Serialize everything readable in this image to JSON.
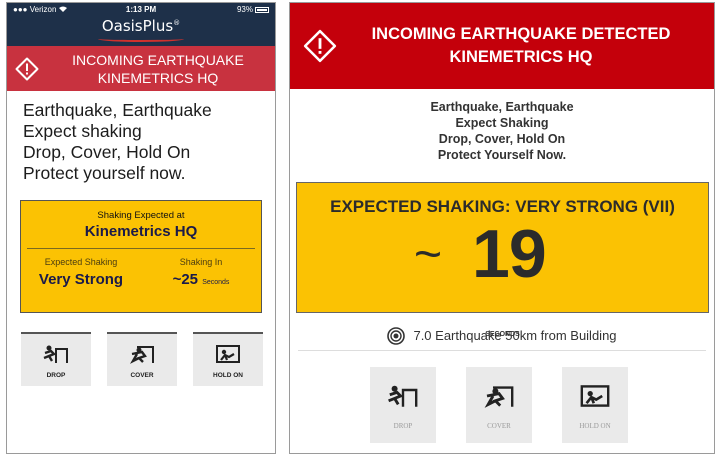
{
  "phone": {
    "status": {
      "carrier": "Verizon",
      "time": "1:13 PM",
      "battery": "93%"
    },
    "app_title": "OasisPlus",
    "banner": {
      "line1": "INCOMING EARTHQUAKE",
      "line2": "KINEMETRICS HQ"
    },
    "message": [
      "Earthquake, Earthquake",
      "Expect shaking",
      "Drop, Cover, Hold On",
      "Protect yourself now."
    ],
    "card": {
      "label": "Shaking Expected at",
      "location": "Kinemetrics HQ",
      "expected_label": "Expected Shaking",
      "expected_value": "Very Strong",
      "in_label": "Shaking In",
      "in_value": "~25",
      "in_unit": "Seconds"
    },
    "actions": [
      "DROP",
      "COVER",
      "HOLD ON"
    ]
  },
  "panel": {
    "banner": {
      "line1": "INCOMING EARTHQUAKE DETECTED",
      "line2": "KINEMETRICS HQ"
    },
    "message": [
      "Earthquake, Earthquake",
      "Expect Shaking",
      "Drop, Cover, Hold On",
      "Protect Yourself Now."
    ],
    "card": {
      "heading": "EXPECTED SHAKING: VERY STRONG (VII)",
      "tilde": "~",
      "countdown": "19",
      "unit": "SECONDS"
    },
    "info": "7.0 Earthquake 50km from Building",
    "actions": [
      "DROP",
      "COVER",
      "HOLD ON"
    ]
  },
  "colors": {
    "status_bar": "#1e3049",
    "phone_banner": "#c8323f",
    "panel_banner": "#c4000b",
    "alert_yellow": "#fbc203"
  },
  "icons": [
    "warning-icon",
    "drop-icon",
    "cover-icon",
    "hold-on-icon",
    "target-icon",
    "wifi-icon",
    "battery-icon"
  ]
}
